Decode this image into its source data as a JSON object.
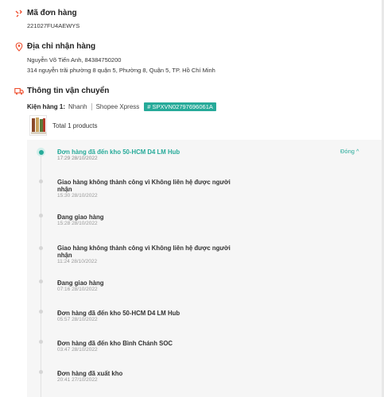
{
  "order": {
    "title": "Mã đơn hàng",
    "code": "221027FU4AEWYS"
  },
  "address": {
    "title": "Địa chỉ nhận hàng",
    "name_phone": "Nguyễn Võ Tiến Anh, 84384750200",
    "street": "314 nguyễn trãi phường 8 quận 5, Phường 8, Quận 5, TP. Hồ Chí Minh"
  },
  "shipping": {
    "title": "Thông tin vận chuyển",
    "parcel_label": "Kiện hàng 1:",
    "speed": "Nhanh",
    "carrier": "Shopee Xpress",
    "tracking": "# SPXVN02797696061A",
    "products_text": "Total 1 products",
    "collapse_label": "Đóng ^"
  },
  "timeline": [
    {
      "title": "Đơn hàng đã đến kho 50-HCM D4 LM Hub",
      "time": "17:29 28/10/2022"
    },
    {
      "title": "Giao hàng không thành công vì Không liên hệ được người nhận",
      "time": "15:30 28/10/2022"
    },
    {
      "title": "Đang giao hàng",
      "time": "15:28 28/10/2022"
    },
    {
      "title": "Giao hàng không thành công vì Không liên hệ được người nhận",
      "time": "11:24 28/10/2022"
    },
    {
      "title": "Đang giao hàng",
      "time": "07:16 28/10/2022"
    },
    {
      "title": "Đơn hàng đã đến kho 50-HCM D4 LM Hub",
      "time": "05:57 28/10/2022"
    },
    {
      "title": "Đơn hàng đã đến kho Bình Chánh SOC",
      "time": "03:47 28/10/2022"
    },
    {
      "title": "Đơn hàng đã xuất kho",
      "time": "20:41 27/10/2022"
    }
  ],
  "colors": {
    "accent": "#26aa99",
    "icon_orange": "#ee4d2d"
  },
  "icons": {
    "order": "order-code-icon",
    "address": "location-pin-icon",
    "shipping": "truck-icon"
  }
}
